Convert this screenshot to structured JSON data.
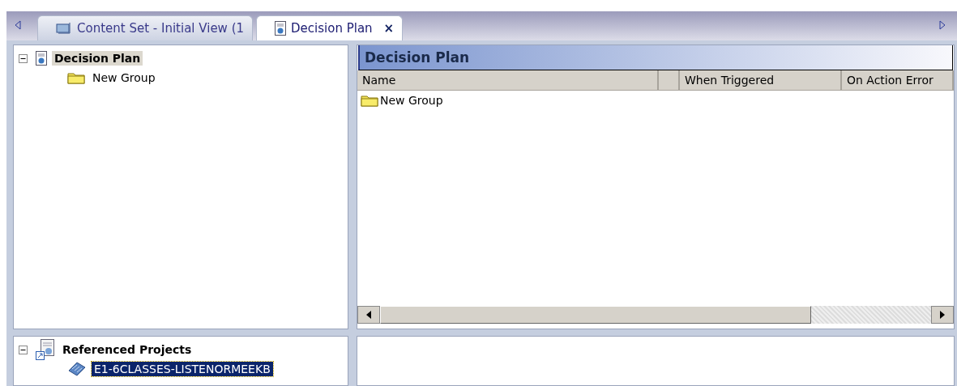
{
  "tabs": [
    {
      "label": "Content Set - Initial View (1",
      "kind": "content",
      "selected": false
    },
    {
      "label": "Decision Plan",
      "kind": "plan",
      "selected": true,
      "close": "×"
    }
  ],
  "tree": [
    {
      "label": "Decision Plan",
      "kind": "plan",
      "expanded": true,
      "selected": true,
      "children": [
        {
          "label": "New Group",
          "kind": "folder",
          "selected": false
        }
      ]
    }
  ],
  "panel": {
    "title": "Decision Plan"
  },
  "table": {
    "columns": [
      "Name",
      "When Triggered",
      "On Action Error"
    ],
    "rows": [
      {
        "name": "New Group"
      }
    ]
  },
  "referenced_tree": [
    {
      "label": "Referenced Projects",
      "kind": "refs",
      "expanded": true,
      "selected": false,
      "children": [
        {
          "label": "E1-6CLASSES-LISTENORMEEKB",
          "kind": "project",
          "selected": true
        }
      ]
    }
  ]
}
